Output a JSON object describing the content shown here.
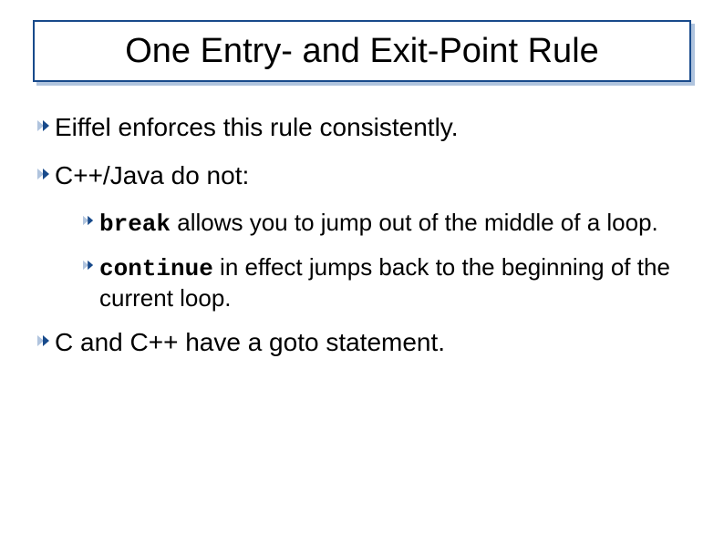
{
  "title": "One Entry- and Exit-Point Rule",
  "bullets": [
    {
      "text": "Eiffel enforces this rule consistently."
    },
    {
      "text": "C++/Java do not:"
    },
    {
      "text": "C and C++ have a goto statement."
    }
  ],
  "sub_bullets": [
    {
      "keyword": "break",
      "rest": " allows you to jump out of the middle of a loop."
    },
    {
      "keyword": "continue",
      "rest": " in effect jumps back to the beginning of the current loop."
    }
  ]
}
